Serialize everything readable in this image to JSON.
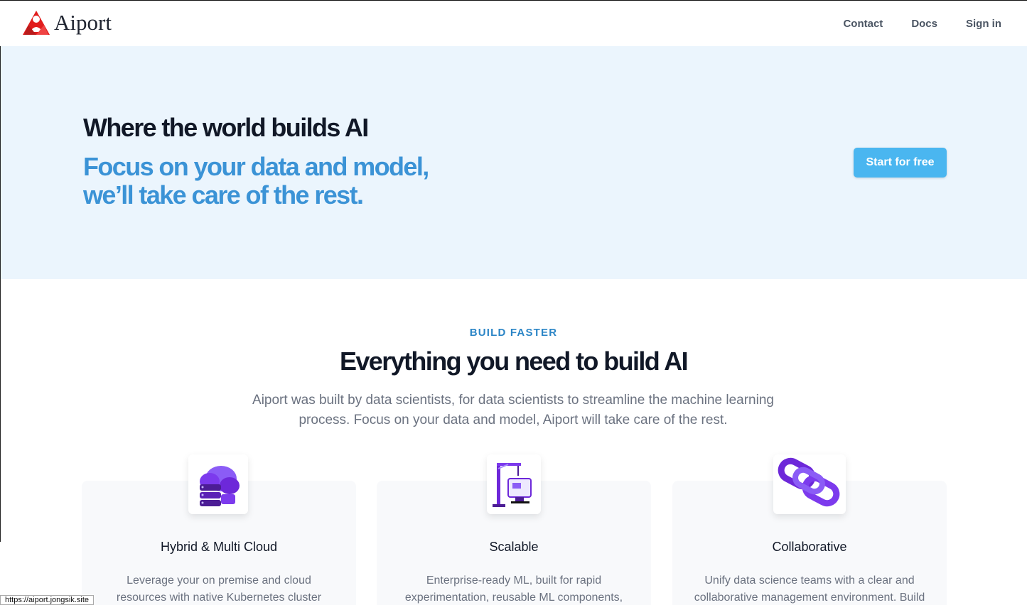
{
  "header": {
    "brand": "Aiport",
    "nav": [
      "Contact",
      "Docs",
      "Sign in"
    ]
  },
  "hero": {
    "title": "Where the world builds AI",
    "subtitle_line1": "Focus on your data and model,",
    "subtitle_line2": "we’ll take care of the rest.",
    "cta_label": "Start for free"
  },
  "features": {
    "eyebrow": "BUILD FASTER",
    "title": "Everything you need to build AI",
    "description_line1": "Aiport was built by data scientists, for data scientists to streamline the machine learning",
    "description_line2": "process. Focus on your data and model, Aiport will take care of the rest.",
    "cards": [
      {
        "title": "Hybrid & Multi Cloud",
        "icon": "cloud-server-icon",
        "desc_line1": "Leverage your on premise and cloud",
        "desc_line2": "resources with native Kubernetes cluster"
      },
      {
        "title": "Scalable",
        "icon": "crane-monitor-icon",
        "desc_line1": "Enterprise-ready ML, built for rapid",
        "desc_line2": "experimentation, reusable ML components,"
      },
      {
        "title": "Collaborative",
        "icon": "chain-link-icon",
        "desc_line1": "Unify data science teams with a clear and",
        "desc_line2": "collaborative management environment. Build"
      }
    ]
  },
  "status_bar": {
    "url": "https://aiport.jongsik.site"
  },
  "colors": {
    "accent": "#3b93d6",
    "cta": "#4ab6f0",
    "hero_bg": "#ebf5fd",
    "icon_purple": "#7c3aed"
  }
}
